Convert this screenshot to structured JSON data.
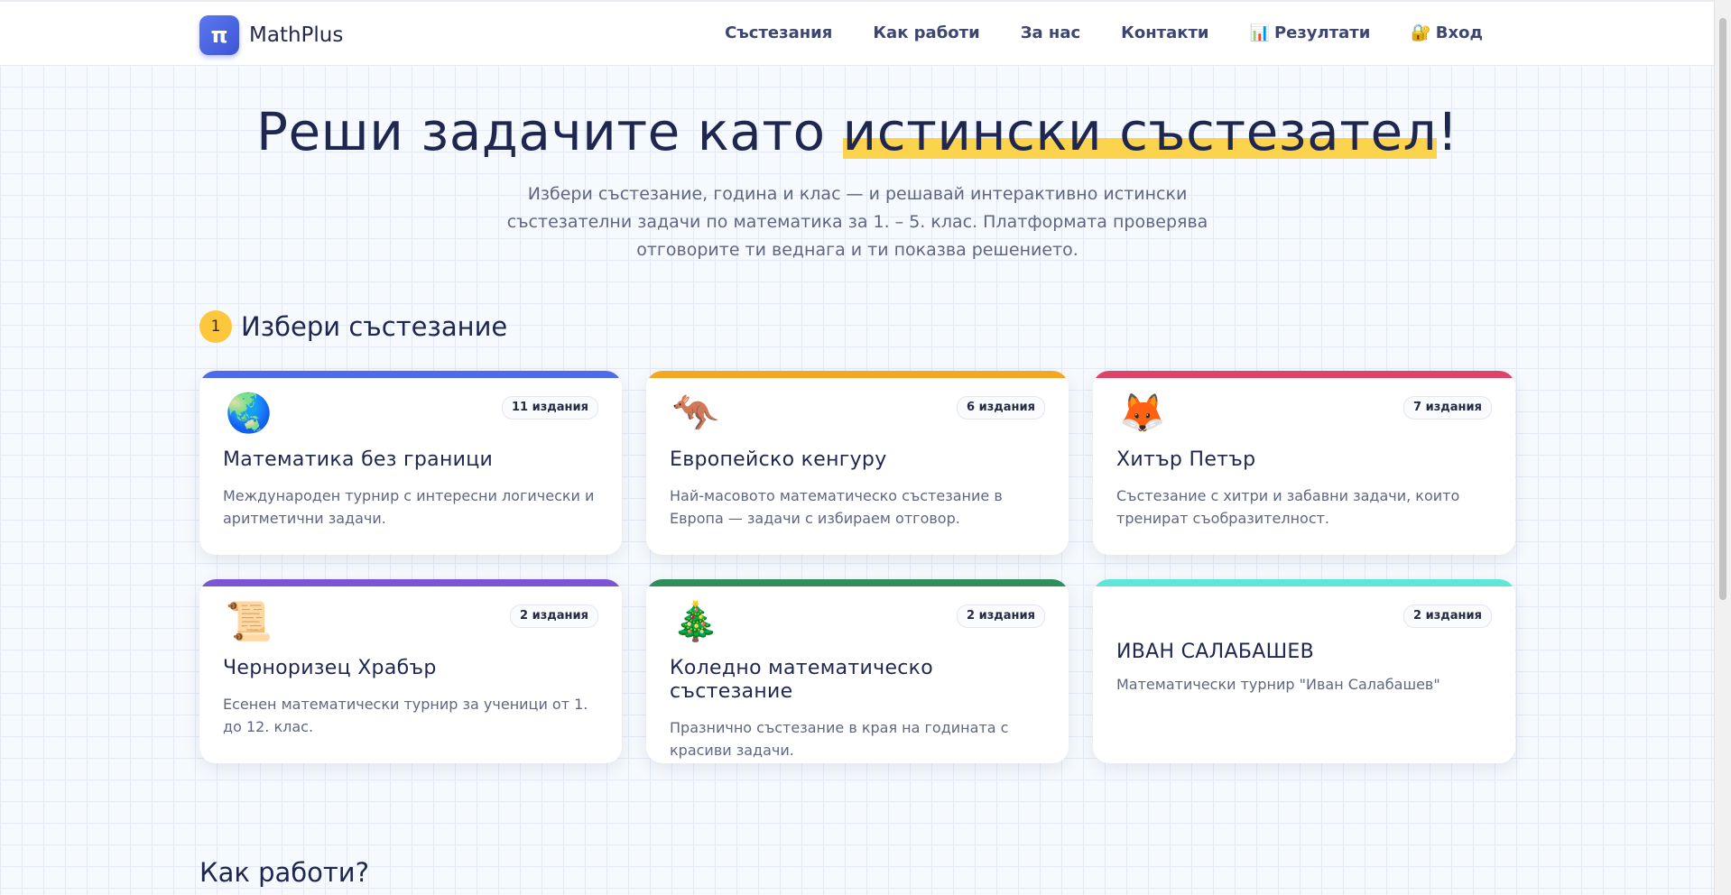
{
  "header": {
    "logo_symbol": "π",
    "logo_text": "MathPlus",
    "nav": [
      {
        "label": "Състезания",
        "icon": ""
      },
      {
        "label": "Как работи",
        "icon": ""
      },
      {
        "label": "За нас",
        "icon": ""
      },
      {
        "label": "Контакти",
        "icon": ""
      },
      {
        "label": "Резултати",
        "icon": "📊"
      },
      {
        "label": "Вход",
        "icon": "🔐"
      }
    ]
  },
  "hero": {
    "title_before": "Реши задачите като ",
    "title_highlight": "истински състезател",
    "title_after": "!",
    "subtitle": "Избери състезание, година и клас — и решавай интерактивно истински състезателни задачи по математика за 1. – 5. клас. Платформата проверява отговорите ти веднага и ти показва решението."
  },
  "step": {
    "number": "1",
    "title": "Избери състезание"
  },
  "competitions": [
    {
      "icon": "🌏",
      "badge": "11 издания",
      "title": "Математика без граници",
      "description": "Международен турнир с интересни логически и аритметични задачи.",
      "accent": "#4f6bed"
    },
    {
      "icon": "🦘",
      "badge": "6 издания",
      "title": "Европейско кенгуру",
      "description": "Най-масовото математическо състезание в Европа — задачи с избираем отговор.",
      "accent": "#f5a623"
    },
    {
      "icon": "🦊",
      "badge": "7 издания",
      "title": "Хитър Петър",
      "description": "Състезание с хитри и забавни задачи, които тренират съобразителност.",
      "accent": "#e0436a"
    },
    {
      "icon": "📜",
      "badge": "2 издания",
      "title": "Черноризец Храбър",
      "description": "Есенен математически турнир за ученици от 1. до 12. клас.",
      "accent": "#7c55d4"
    },
    {
      "icon": "🎄",
      "badge": "2 издания",
      "title": "Коледно математическо състезание",
      "description": "Празнично състезание в края на годината с красиви задачи.",
      "accent": "#2f8f5b"
    },
    {
      "icon": "",
      "badge": "2 издания",
      "title": "ИВАН САЛАБАШЕВ",
      "description": "Математически турнир \"Иван Салабашев\"",
      "accent": "#5ee6d8"
    }
  ],
  "next_section": {
    "title": "Как работи?"
  }
}
